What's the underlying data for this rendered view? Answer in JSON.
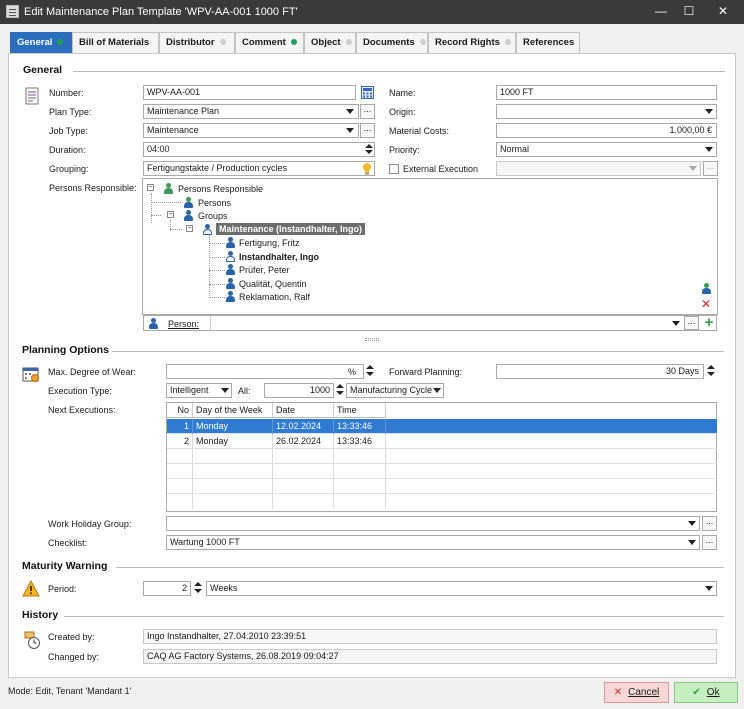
{
  "window": {
    "title": "Edit Maintenance Plan Template 'WPV-AA-001 1000 FT'",
    "minimize": "—",
    "maximize": "☐",
    "close": "✕"
  },
  "tabs": [
    {
      "label": "General",
      "dot": "green"
    },
    {
      "label": "Bill of Materials",
      "dot": "none"
    },
    {
      "label": "Distributor",
      "dot": "grey"
    },
    {
      "label": "Comment",
      "dot": "green"
    },
    {
      "label": "Object",
      "dot": "grey"
    },
    {
      "label": "Documents",
      "dot": "grey"
    },
    {
      "label": "Record Rights",
      "dot": "grey"
    },
    {
      "label": "References",
      "dot": "none"
    }
  ],
  "general": {
    "heading": "General",
    "number_label": "Number:",
    "number_value": "WPV-AA-001",
    "name_label": "Name:",
    "name_value": "1000 FT",
    "plan_type_label": "Plan Type:",
    "plan_type_value": "Maintenance Plan",
    "origin_label": "Origin:",
    "origin_value": "",
    "job_type_label": "Job Type:",
    "job_type_value": "Maintenance",
    "material_costs_label": "Material Costs:",
    "material_costs_value": "1.000,00 €",
    "duration_label": "Duration:",
    "duration_value": "04:00",
    "priority_label": "Priority:",
    "priority_value": "Normal",
    "grouping_label": "Grouping:",
    "grouping_value": "Fertigungstakte / Production cycles",
    "external_execution_label": "External Execution",
    "external_execution_value": "",
    "persons_responsible_label": "Persons Responsible:",
    "tree": {
      "root": "Persons Responsible",
      "persons": "Persons",
      "groups": "Groups",
      "group_selected": "Maintenance (Instandhalter, Ingo)",
      "members": [
        {
          "name": "Fertigung, Fritz",
          "bold": false
        },
        {
          "name": "Instandhalter, Ingo",
          "bold": true
        },
        {
          "name": "Prüfer, Peter",
          "bold": false
        },
        {
          "name": "Qualität, Quentin",
          "bold": false
        },
        {
          "name": "Reklamation, Ralf",
          "bold": false
        }
      ]
    },
    "person_label": "Person:",
    "person_value": "",
    "dots": "..."
  },
  "planning": {
    "heading": "Planning Options",
    "max_wear_label": "Max. Degree of Wear:",
    "max_wear_value": "",
    "max_wear_unit": "%",
    "forward_planning_label": "Forward Planning:",
    "forward_planning_value": "30  Days",
    "execution_type_label": "Execution Type:",
    "execution_type_value": "Intelligent",
    "all_label": "All:",
    "all_value": "1000",
    "all_unit": "Manufacturing Cycle",
    "next_executions_label": "Next Executions:",
    "grid_columns": [
      "No",
      "Day of the Week",
      "Date",
      "Time"
    ],
    "grid_rows": [
      {
        "no": "1",
        "day": "Monday",
        "date": "12.02.2024",
        "time": "13:33:46",
        "selected": true
      },
      {
        "no": "2",
        "day": "Monday",
        "date": "26.02.2024",
        "time": "13:33:46",
        "selected": false
      }
    ],
    "work_holiday_label": "Work Holiday Group:",
    "work_holiday_value": "",
    "checklist_label": "Checklist:",
    "checklist_value": "Wartung 1000 FT"
  },
  "maturity": {
    "heading": "Maturity Warning",
    "period_label": "Period:",
    "period_value": "2",
    "period_unit": "Weeks"
  },
  "history": {
    "heading": "History",
    "created_label": "Created by:",
    "created_value": "Ingo Instandhalter, 27.04.2010 23:39:51",
    "changed_label": "Changed by:",
    "changed_value": "CAQ AG Factory Systems, 26.08.2019 09:04:27"
  },
  "status": "Mode: Edit, Tenant 'Mandant 1'",
  "buttons": {
    "cancel": "Cancel",
    "ok": "Ok"
  },
  "colors": {
    "accent": "#2a6ebd",
    "selection": "#2f7ad2",
    "title_bar": "#3a3a3a",
    "green_dot": "#1aa05a",
    "cancel_bg": "#f6d6d6",
    "ok_bg": "#c5efc0"
  }
}
